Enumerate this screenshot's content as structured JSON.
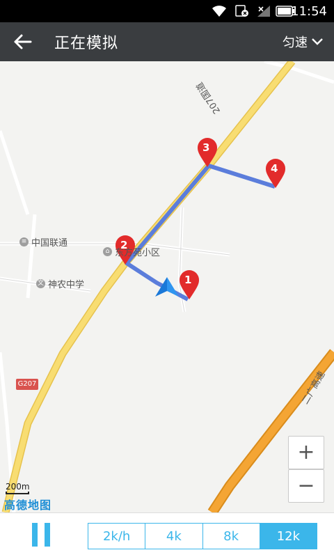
{
  "status_bar": {
    "time": "11:54"
  },
  "header": {
    "title": "正在模拟",
    "speed_mode": "匀速"
  },
  "map": {
    "poi": [
      {
        "label": "中国联通"
      },
      {
        "label": "东方苑小区"
      },
      {
        "label": "神农中学"
      }
    ],
    "roads": {
      "national_road": "207国道",
      "highway": "二广高速",
      "shield": "G207"
    },
    "markers": [
      "1",
      "2",
      "3",
      "4"
    ],
    "scale_label": "200m",
    "brand": "高德地图",
    "zoom_in": "+",
    "zoom_out": "−"
  },
  "bottom": {
    "speeds": [
      {
        "label": "2k/h",
        "active": false
      },
      {
        "label": "4k",
        "active": false
      },
      {
        "label": "8k",
        "active": false
      },
      {
        "label": "12k",
        "active": true
      }
    ]
  },
  "colors": {
    "accent": "#3bb6ea",
    "header": "#3a3d40",
    "route": "#5b7ddb",
    "marker": "#e22b2b",
    "national_road": "#f6d66b",
    "highway": "#f2a42a"
  }
}
